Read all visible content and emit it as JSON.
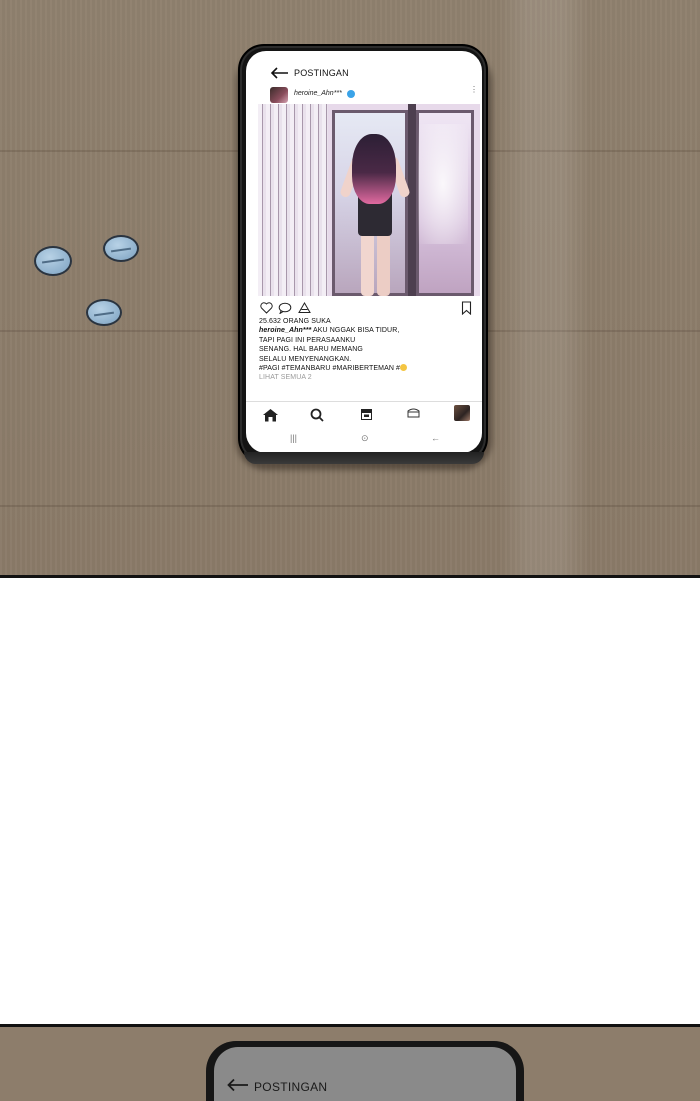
{
  "post": {
    "header_title": "POSTINGAN",
    "username": "heroine_Ahn***",
    "likes": "25.632 ORANG SUKA",
    "caption_user": "heroine_Ahn***",
    "caption_lines": [
      " AKU NGGAK BISA TIDUR,",
      "TAPI PAGI INI PERASAANKU",
      "SENANG. HAL BARU MEMANG",
      "SELALU MENYENANGKAN.",
      "#PAGI #TEMANBARU #MARIBERTEMAN #"
    ],
    "view_all": "LIHAT SEMUA 2"
  },
  "system_nav": {
    "recent": "|||",
    "home": "⊙",
    "back": "←"
  },
  "panel3": {
    "header_title": "POSTINGAN"
  },
  "colors": {
    "table": "#8d7d6b",
    "pill": "#8eb0cc",
    "verified": "#3aa3e8"
  },
  "icons": [
    "back-arrow-icon",
    "verified-icon",
    "more-icon",
    "heart-icon",
    "comment-icon",
    "share-icon",
    "bookmark-icon",
    "home-icon",
    "search-icon",
    "reels-icon",
    "shop-icon"
  ]
}
